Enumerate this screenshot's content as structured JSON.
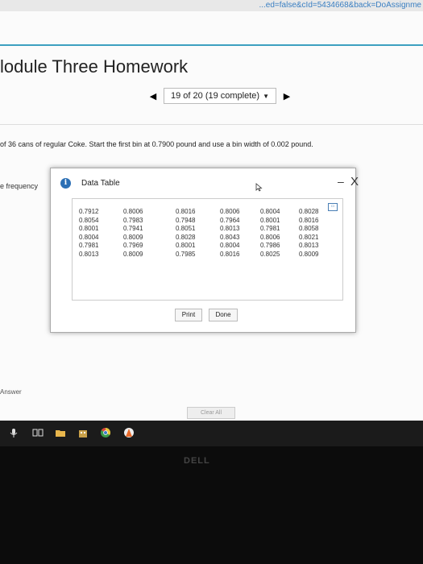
{
  "browser": {
    "url_fragment": "...ed=false&cId=5434668&back=DoAssignme"
  },
  "page": {
    "title": "lodule Three Homework",
    "pager": {
      "prev_label": "◀",
      "next_label": "▶",
      "status_text": "19 of 20 (19 complete)",
      "dropdown_icon": "▼"
    },
    "instructions": "of 36 cans of regular Coke. Start the first bin at 0.7900 pound and use a bin width of 0.002 pound.",
    "frequency_label": "e frequency",
    "answer_label": "Answer",
    "clear_all_label": "Clear All"
  },
  "dialog": {
    "title": "Data Table",
    "info_icon": "i",
    "minimize_label": "–",
    "close_label": "X",
    "copy_icon": "▭",
    "columns": [
      [
        "0.7912",
        "0.8054",
        "0.8001",
        "0.8004",
        "0.7981",
        "0.8013"
      ],
      [
        "0.8006",
        "0.7983",
        "0.7941",
        "0.8009",
        "0.7969",
        "0.8009"
      ],
      [
        "0.8016",
        "0.7948",
        "0.8051",
        "0.8028",
        "0.8001",
        "0.7985"
      ],
      [
        "0.8006",
        "0.7964",
        "0.8013",
        "0.8043",
        "0.8004",
        "0.8016"
      ],
      [
        "0.8004",
        "0.8001",
        "0.7981",
        "0.8006",
        "0.7986",
        "0.8025"
      ],
      [
        "0.8028",
        "0.8016",
        "0.8058",
        "0.8021",
        "0.8013",
        "0.8009"
      ]
    ],
    "print_label": "Print",
    "done_label": "Done"
  },
  "device": {
    "brand": "DELL"
  }
}
